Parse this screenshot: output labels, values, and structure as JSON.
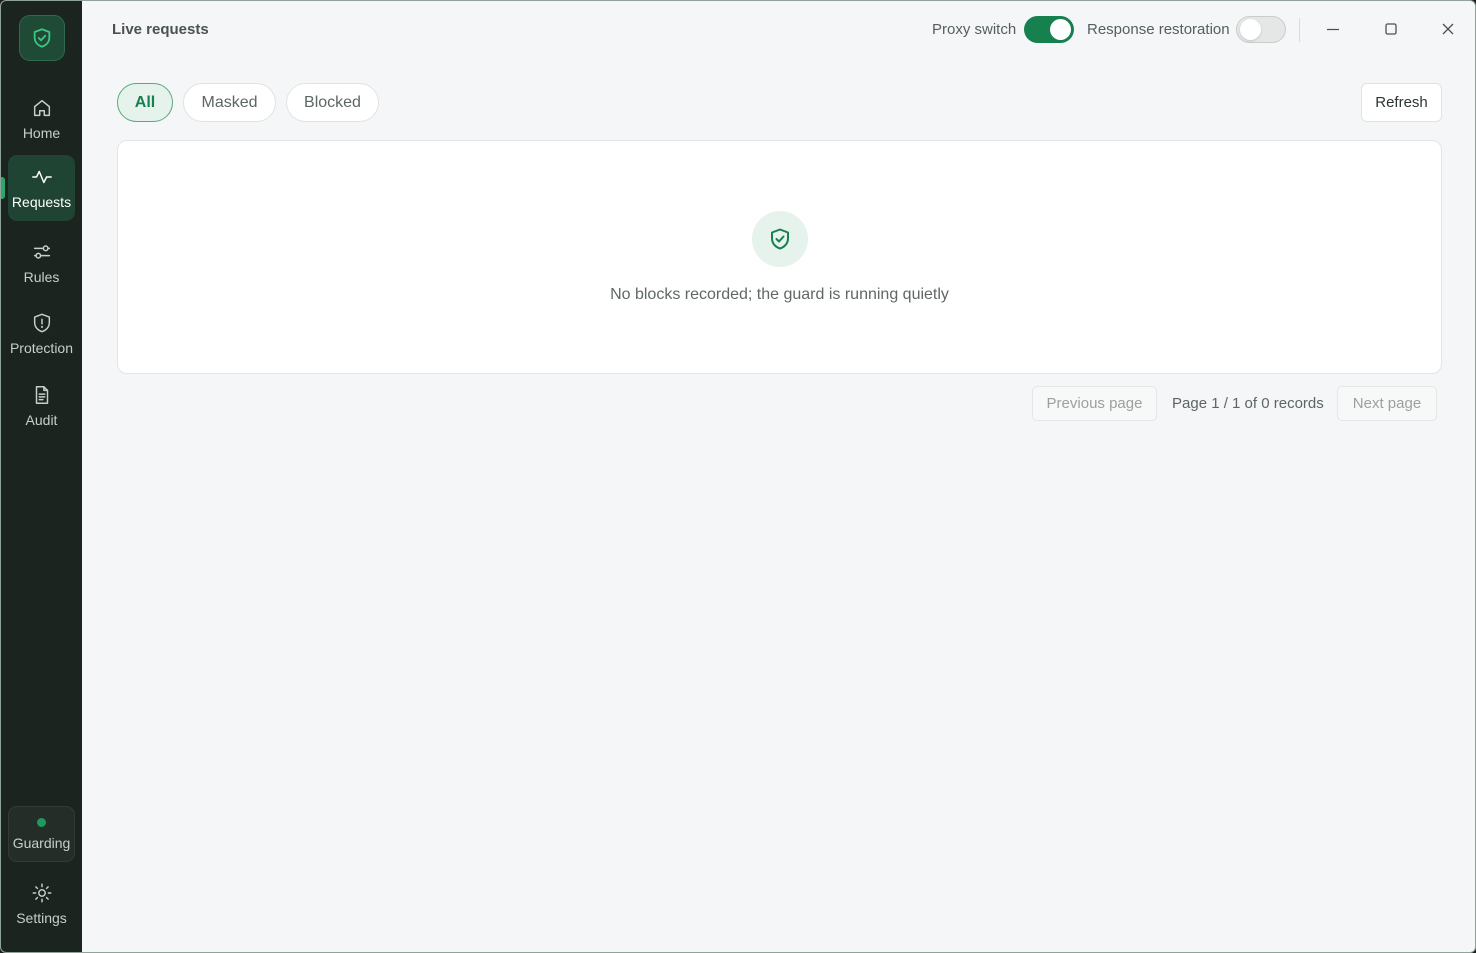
{
  "app": {
    "logo_icon": "shield-check-icon",
    "colors": {
      "accent": "#17804f",
      "sidebar_bg": "#1c2420",
      "active_nav": "#1f4433",
      "status_green": "#1f9a5e"
    }
  },
  "sidebar": {
    "items": [
      {
        "label": "Home",
        "icon": "home-icon",
        "active": false
      },
      {
        "label": "Requests",
        "icon": "activity-icon",
        "active": true
      },
      {
        "label": "Rules",
        "icon": "sliders-icon",
        "active": false
      },
      {
        "label": "Protection",
        "icon": "shield-icon",
        "active": false
      },
      {
        "label": "Audit",
        "icon": "document-icon",
        "active": false
      }
    ],
    "status": {
      "label": "Guarding",
      "state": "active"
    },
    "settings": {
      "label": "Settings",
      "icon": "gear-icon"
    }
  },
  "header": {
    "title": "Live requests",
    "proxy_switch": {
      "label": "Proxy switch",
      "on": true
    },
    "response_restoration": {
      "label": "Response restoration",
      "on": false
    }
  },
  "filters": {
    "tabs": [
      {
        "label": "All",
        "active": true
      },
      {
        "label": "Masked",
        "active": false
      },
      {
        "label": "Blocked",
        "active": false
      }
    ],
    "refresh_label": "Refresh"
  },
  "empty_state": {
    "icon": "shield-check-icon",
    "message": "No blocks recorded; the guard is running quietly"
  },
  "pagination": {
    "prev_label": "Previous page",
    "info": "Page 1 / 1 of 0 records",
    "next_label": "Next page"
  }
}
